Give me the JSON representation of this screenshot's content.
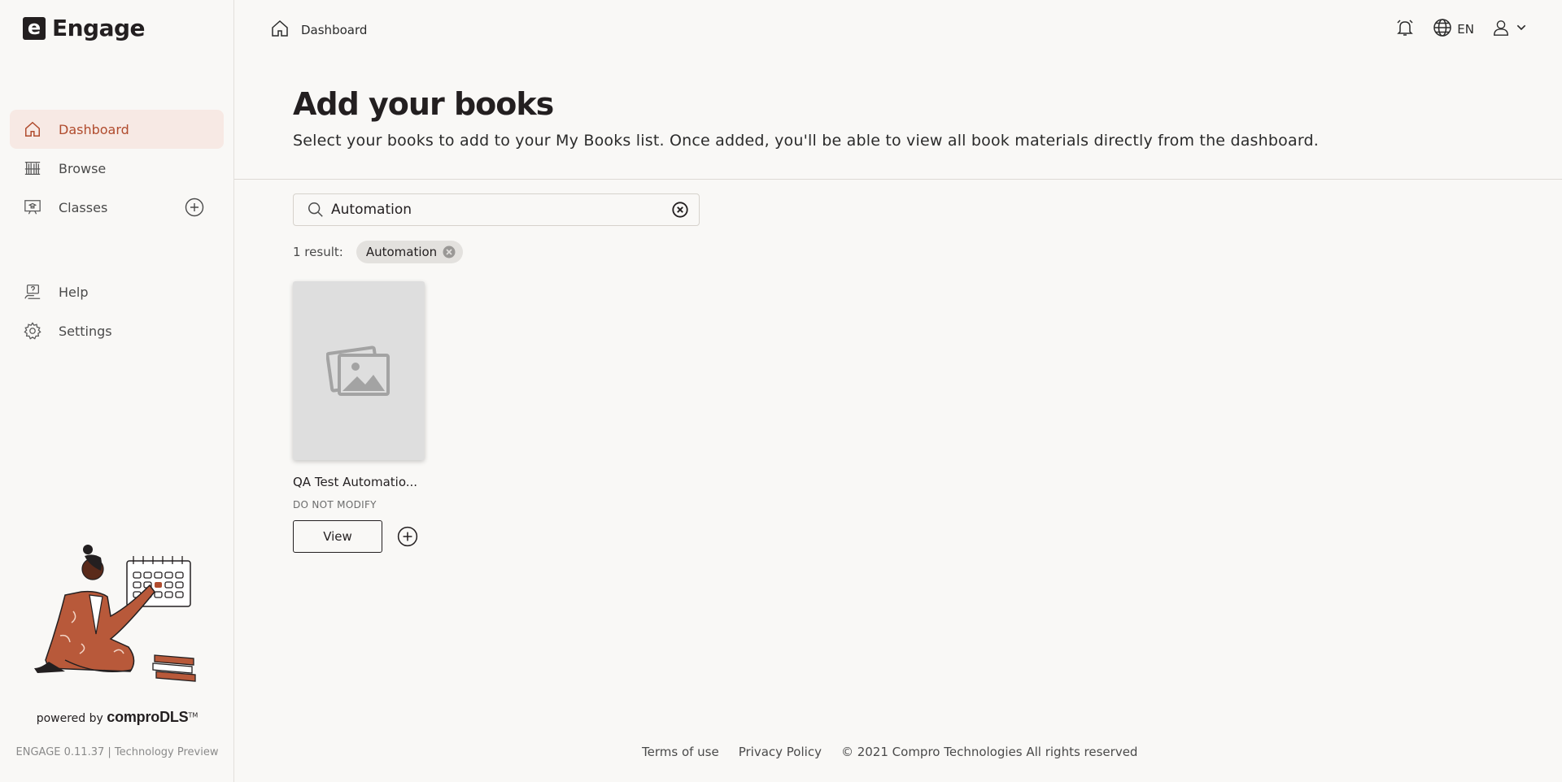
{
  "app": {
    "logo_letter": "e",
    "name": "Engage"
  },
  "sidebar": {
    "items": [
      {
        "label": "Dashboard",
        "icon": "home-icon",
        "active": true
      },
      {
        "label": "Browse",
        "icon": "bookshelf-icon"
      },
      {
        "label": "Classes",
        "icon": "classroom-icon"
      }
    ],
    "secondary": [
      {
        "label": "Help",
        "icon": "help-icon"
      },
      {
        "label": "Settings",
        "icon": "gear-icon"
      }
    ],
    "powered_prefix": "powered by",
    "powered_brand": "comproDLS",
    "powered_tm": "TM",
    "version": "ENGAGE 0.11.37 | Technology Preview"
  },
  "header": {
    "breadcrumb": "Dashboard",
    "language": "EN"
  },
  "main": {
    "title": "Add your books",
    "subtitle": "Select your books to add to your My Books list. Once added, you'll be able to view all book materials directly from the dashboard.",
    "search": {
      "value": "Automation",
      "placeholder": "Search"
    },
    "result_count": "1 result:",
    "filter_chip": "Automation",
    "books": [
      {
        "title": "QA Test Automatio...",
        "subtitle": "DO NOT MODIFY",
        "view_label": "View"
      }
    ]
  },
  "footer": {
    "terms": "Terms of use",
    "privacy": "Privacy Policy",
    "copyright": "© 2021 Compro Technologies All rights reserved"
  },
  "colors": {
    "accent": "#b04b2d",
    "active_bg": "#f7e9e4",
    "background": "#f9f8f6"
  }
}
